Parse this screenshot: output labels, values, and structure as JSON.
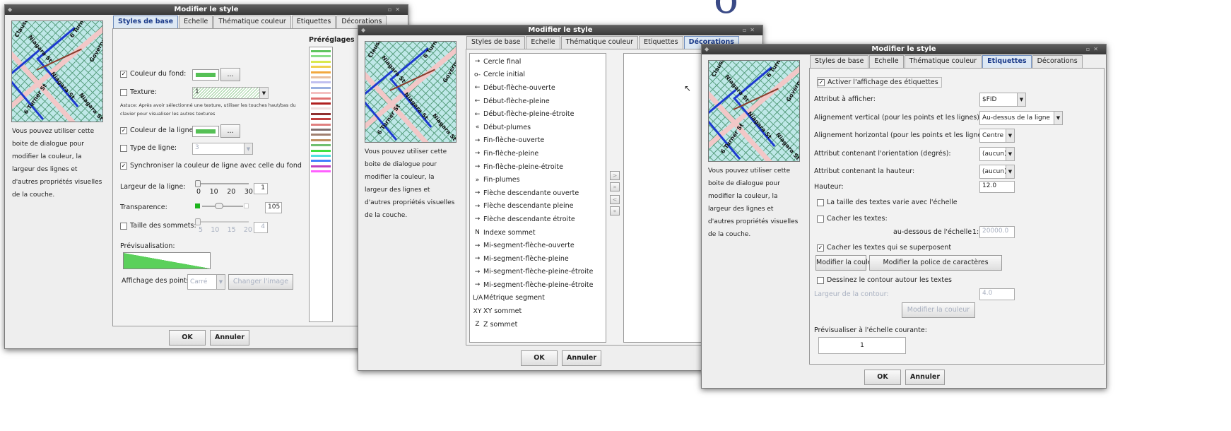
{
  "background": {
    "title_fragment": "o"
  },
  "window_title": "Modifier le style",
  "tabs": [
    "Styles de base",
    "Echelle",
    "Thématique couleur",
    "Etiquettes",
    "Décorations"
  ],
  "map_labels": [
    "Niagara St",
    "6 Turner St",
    "Governme",
    "Niagara St",
    "Governme",
    "Niagara St",
    "Clause",
    "Niagara",
    "6 Turner St"
  ],
  "description": [
    "Vous pouvez utiliser cette",
    "boite de dialogue pour",
    "modifier la couleur, la",
    "largeur des lignes et",
    "d'autres propriétés visuelles",
    "de la couche."
  ],
  "buttons": {
    "ok": "OK",
    "cancel": "Annuler"
  },
  "win1": {
    "presets_title": "Préréglages",
    "fill_color_label": "Couleur du fond:",
    "texture_label": "Texture:",
    "texture_value": "1",
    "hint_line1": "Astuce: Après avoir sélectionné une texture, utiliser les touches haut/bas du",
    "hint_line2": "clavier pour visualiser les autres textures",
    "line_color_label": "Couleur de la ligne:",
    "line_type_label": "Type de ligne:",
    "line_type_value": "3",
    "sync_label": "Synchroniser la couleur de ligne avec celle du fond",
    "line_width_label": "Largeur de la ligne:",
    "line_width_ticks": [
      "0",
      "10",
      "20",
      "30"
    ],
    "line_width_value": "1",
    "transparency_label": "Transparence:",
    "transparency_value": "105",
    "vertex_size_label": "Taille des sommets:",
    "vertex_ticks": [
      "5",
      "10",
      "15",
      "20"
    ],
    "vertex_value": "4",
    "preview_label": "Prévisualisation:",
    "points_label": "Affichage des points",
    "points_value": "Carré",
    "change_image": "Changer l'image",
    "color_btn": "...",
    "preset_colors": [
      "#5ec45e",
      "#8adf8a",
      "#d9e94f",
      "#f0d050",
      "#f2a840",
      "#e9c0a0",
      "#c0c0f0",
      "#9ab0e0",
      "#f4c0c0",
      "#e07070",
      "#b02020",
      "#f0e0e0",
      "#903030",
      "#c04040",
      "#e08080",
      "#807070",
      "#a08070",
      "#c09060",
      "#70c070",
      "#40e040",
      "#50e0e0",
      "#4080ff",
      "#c040c0",
      "#ff60ff"
    ]
  },
  "win2": {
    "decorations": [
      {
        "icon": "→",
        "label": "Cercle final"
      },
      {
        "icon": "o-",
        "label": "Cercle initial"
      },
      {
        "icon": "←",
        "label": "Début-flèche-ouverte"
      },
      {
        "icon": "←",
        "label": "Début-flèche-pleine"
      },
      {
        "icon": "←",
        "label": "Début-flèche-pleine-étroite"
      },
      {
        "icon": "«",
        "label": "Début-plumes"
      },
      {
        "icon": "→",
        "label": "Fin-flèche-ouverte"
      },
      {
        "icon": "→",
        "label": "Fin-flèche-pleine"
      },
      {
        "icon": "→",
        "label": "Fin-flèche-pleine-étroite"
      },
      {
        "icon": "»",
        "label": "Fin-plumes"
      },
      {
        "icon": "→",
        "label": "Flèche descendante ouverte"
      },
      {
        "icon": "→",
        "label": "Flèche descendante pleine"
      },
      {
        "icon": "→",
        "label": "Flèche descendante étroite"
      },
      {
        "icon": "N",
        "label": "Indexe sommet"
      },
      {
        "icon": "→",
        "label": "Mi-segment-flèche-ouverte"
      },
      {
        "icon": "→",
        "label": "Mi-segment-flèche-pleine"
      },
      {
        "icon": "→",
        "label": "Mi-segment-flèche-pleine-étroite"
      },
      {
        "icon": "→",
        "label": "Mi-segment-flèche-pleine-étroite"
      },
      {
        "icon": "L/A",
        "label": "Métrique segment"
      },
      {
        "icon": "XY",
        "label": "XY sommet"
      },
      {
        "icon": "Z",
        "label": "Z sommet"
      }
    ],
    "transfer_buttons": [
      ">",
      "»",
      "<",
      "«"
    ]
  },
  "win3": {
    "activate_label": "Activer l'affichage des étiquettes",
    "attr_label": "Attribut à afficher:",
    "attr_value": "$FID",
    "valign_label": "Alignement vertical (pour les points et les lignes):",
    "valign_value": "Au-dessus de la ligne",
    "halign_label": "Alignement horizontal (pour les points et les lignes):",
    "halign_value": "Centre",
    "orient_label": "Attribut contenant l'orientation (degrés):",
    "orient_value": "(aucun)",
    "height_attr_label": "Attribut contenant la hauteur:",
    "height_attr_value": "(aucun)",
    "height_label": "Hauteur:",
    "height_value": "12.0",
    "scale_label": "La taille des textes varie avec l'échelle",
    "hide_label": "Cacher les textes:",
    "below_label": "au-dessous de l'échelle",
    "scale_ratio": "1:",
    "scale_value": "20000.0",
    "overlap_label": "Cacher les textes qui se superposent",
    "change_color": "Modifier la couleur",
    "change_font": "Modifier la police de caractères",
    "outline_label": "Dessinez le contour autour les textes",
    "outline_width_label": "Largeur de la contour:",
    "outline_width_value": "4.0",
    "outline_color": "Modifier la couleur",
    "preview_label": "Prévisualiser à l'échelle courante:",
    "preview_value": "1"
  }
}
